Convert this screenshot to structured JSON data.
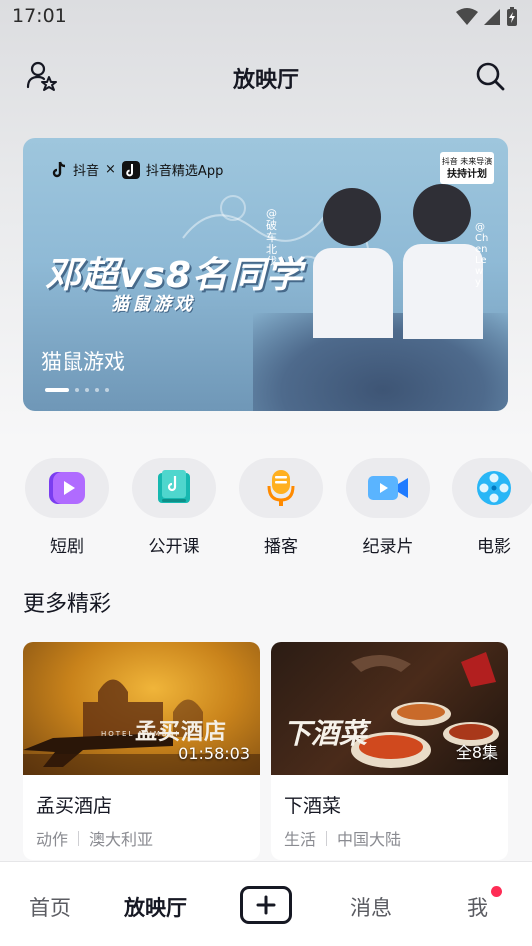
{
  "status_bar": {
    "time": "17:01"
  },
  "header": {
    "title": "放映厅"
  },
  "banner": {
    "logo_text": "抖音",
    "logo_x": "×",
    "logo_app": "抖音精选App",
    "badge_line1": "抖音 未来导演",
    "badge_line2": "扶持计划",
    "headline": "邓超vs8名同学",
    "subheadline": "猫鼠游戏",
    "handle_left": "@破车北伐",
    "handle_right": "@ChenLewy",
    "title": "猫鼠游戏",
    "page_count": 5,
    "active_page": 1
  },
  "categories": [
    {
      "label": "短剧",
      "icon": "short-drama-icon"
    },
    {
      "label": "公开课",
      "icon": "open-course-icon"
    },
    {
      "label": "播客",
      "icon": "podcast-icon"
    },
    {
      "label": "纪录片",
      "icon": "documentary-icon"
    },
    {
      "label": "电影",
      "icon": "movie-icon"
    }
  ],
  "section": {
    "title": "更多精彩"
  },
  "cards": [
    {
      "title": "孟买酒店",
      "overlay_title": "孟买酒店",
      "overlay_small": "HOTEL MUMBAI",
      "duration": "01:58:03",
      "genre": "动作",
      "region": "澳大利亚"
    },
    {
      "title": "下酒菜",
      "overlay_title": "下酒菜",
      "episodes": "全8集",
      "genre": "生活",
      "region": "中国大陆"
    }
  ],
  "bottom_nav": {
    "home": "首页",
    "theater": "放映厅",
    "messages": "消息",
    "me": "我"
  },
  "colors": {
    "accent": "#fe2c55",
    "text_primary": "#161823",
    "text_secondary": "#8a8b91",
    "background": "#f7f7f8"
  }
}
